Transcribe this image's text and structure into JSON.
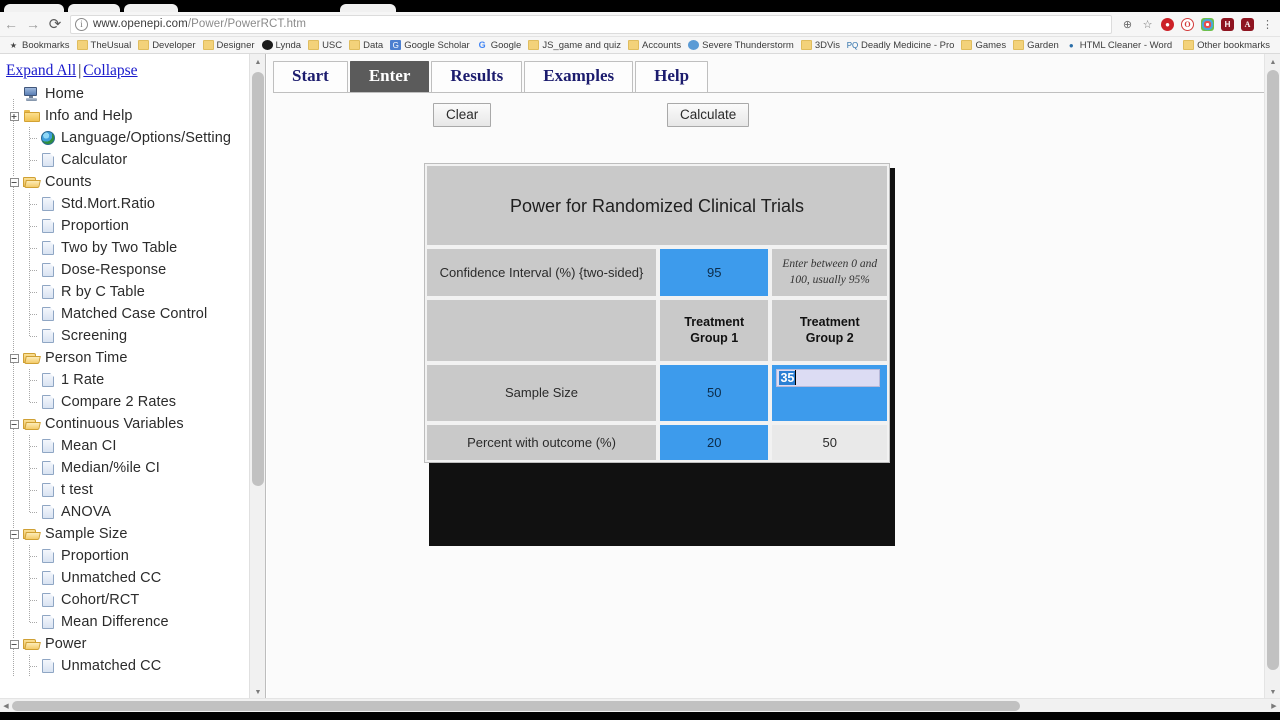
{
  "browser": {
    "url_prefix": "www.openepi.com",
    "url_path": "/Power/PowerRCT.htm",
    "back_icon": "←",
    "forward_icon": "→",
    "reload_icon": "⟳",
    "info_icon": "i",
    "zoom_icon": "⊕",
    "star_icon": "☆",
    "menu_icon": "⋮",
    "extensions": [
      {
        "name": "adblock-extension-icon",
        "glyph": "⛔",
        "color": "#cc2027"
      },
      {
        "name": "opera-extension-icon",
        "glyph": "O",
        "color": "#d23b3b"
      },
      {
        "name": "colorpicker-extension-icon",
        "glyph": "✿",
        "color": "#4aa8d8"
      },
      {
        "name": "evernote-extension-icon",
        "glyph": "H",
        "color": "#8e1420"
      },
      {
        "name": "adobe-acrobat-extension-icon",
        "glyph": "A",
        "color": "#8e1420"
      }
    ],
    "bookmarks": [
      {
        "label": "Bookmarks",
        "icon": "star"
      },
      {
        "label": "TheUsual",
        "icon": "folder"
      },
      {
        "label": "Developer",
        "icon": "folder"
      },
      {
        "label": "Designer",
        "icon": "folder"
      },
      {
        "label": "Lynda",
        "icon": "dark"
      },
      {
        "label": "USC",
        "icon": "folder"
      },
      {
        "label": "Data",
        "icon": "folder"
      },
      {
        "label": "Google Scholar",
        "icon": "scholar"
      },
      {
        "label": "Google",
        "icon": "google"
      },
      {
        "label": "JS_game and quiz",
        "icon": "folder"
      },
      {
        "label": "Accounts",
        "icon": "folder"
      },
      {
        "label": "Severe Thunderstorm",
        "icon": "blue"
      },
      {
        "label": "3DVis",
        "icon": "folder"
      },
      {
        "label": "Deadly Medicine - Pro",
        "icon": "pq"
      },
      {
        "label": "Games",
        "icon": "folder"
      },
      {
        "label": "Garden",
        "icon": "folder"
      },
      {
        "label": "HTML Cleaner - Word",
        "icon": "person"
      }
    ],
    "other_bookmarks": {
      "label": "Other bookmarks",
      "icon": "folder"
    }
  },
  "sidebar": {
    "expand_all": "Expand All",
    "separator": "|",
    "collapse": "Collapse",
    "nodes": [
      {
        "label": "Home",
        "depth": 0,
        "icon": "home",
        "expander": "none"
      },
      {
        "label": "Info and Help",
        "depth": 0,
        "icon": "folder",
        "expander": "plus"
      },
      {
        "label": "Language/Options/Setting",
        "depth": 1,
        "icon": "globe",
        "expander": "none"
      },
      {
        "label": "Calculator",
        "depth": 1,
        "icon": "page",
        "expander": "none"
      },
      {
        "label": "Counts",
        "depth": 0,
        "icon": "folderopen",
        "expander": "minus"
      },
      {
        "label": "Std.Mort.Ratio",
        "depth": 1,
        "icon": "page",
        "expander": "none"
      },
      {
        "label": "Proportion",
        "depth": 1,
        "icon": "page",
        "expander": "none"
      },
      {
        "label": "Two by Two Table",
        "depth": 1,
        "icon": "page",
        "expander": "none"
      },
      {
        "label": "Dose-Response",
        "depth": 1,
        "icon": "page",
        "expander": "none"
      },
      {
        "label": "R by C Table",
        "depth": 1,
        "icon": "page",
        "expander": "none"
      },
      {
        "label": "Matched Case Control",
        "depth": 1,
        "icon": "page",
        "expander": "none"
      },
      {
        "label": "Screening",
        "depth": 1,
        "icon": "page",
        "expander": "none",
        "last": true
      },
      {
        "label": "Person Time",
        "depth": 0,
        "icon": "folderopen",
        "expander": "minus"
      },
      {
        "label": "1 Rate",
        "depth": 1,
        "icon": "page",
        "expander": "none"
      },
      {
        "label": "Compare 2 Rates",
        "depth": 1,
        "icon": "page",
        "expander": "none",
        "last": true
      },
      {
        "label": "Continuous Variables",
        "depth": 0,
        "icon": "folderopen",
        "expander": "minus"
      },
      {
        "label": "Mean CI",
        "depth": 1,
        "icon": "page",
        "expander": "none"
      },
      {
        "label": "Median/%ile CI",
        "depth": 1,
        "icon": "page",
        "expander": "none"
      },
      {
        "label": "t test",
        "depth": 1,
        "icon": "page",
        "expander": "none"
      },
      {
        "label": "ANOVA",
        "depth": 1,
        "icon": "page",
        "expander": "none",
        "last": true
      },
      {
        "label": "Sample Size",
        "depth": 0,
        "icon": "folderopen",
        "expander": "minus"
      },
      {
        "label": "Proportion",
        "depth": 1,
        "icon": "page",
        "expander": "none"
      },
      {
        "label": "Unmatched CC",
        "depth": 1,
        "icon": "page",
        "expander": "none"
      },
      {
        "label": "Cohort/RCT",
        "depth": 1,
        "icon": "page",
        "expander": "none"
      },
      {
        "label": "Mean Difference",
        "depth": 1,
        "icon": "page",
        "expander": "none",
        "last": true
      },
      {
        "label": "Power",
        "depth": 0,
        "icon": "folderopen",
        "expander": "minus"
      },
      {
        "label": "Unmatched CC",
        "depth": 1,
        "icon": "page",
        "expander": "none"
      }
    ]
  },
  "main": {
    "tabs": [
      {
        "label": "Start",
        "active": false
      },
      {
        "label": "Enter",
        "active": true
      },
      {
        "label": "Results",
        "active": false
      },
      {
        "label": "Examples",
        "active": false
      },
      {
        "label": "Help",
        "active": false
      }
    ],
    "clear_button": "Clear",
    "calculate_button": "Calculate",
    "calculator": {
      "title": "Power for Randomized Clinical Trials",
      "rows": [
        {
          "type": "input-hint",
          "label": "Confidence Interval (%)  {two-sided}",
          "value": "95",
          "hint": "Enter between 0 and 100, usually 95%"
        },
        {
          "type": "group-header",
          "label": "",
          "group1": "Treatment\nGroup 1",
          "group2": "Treatment\nGroup 2"
        },
        {
          "type": "two-value",
          "label": "Sample Size",
          "group1_value": "50",
          "group2_value": "35",
          "group2_editing": true
        },
        {
          "type": "two-value",
          "label": "Percent with outcome (%)",
          "group1_value": "20",
          "group2_value": "50",
          "group2_editing": false
        }
      ],
      "accent_blue": "#3d9bec",
      "cell_gray": "#c9c9c9",
      "plain_cell": "#e9e9e9",
      "selection_blue": "#2a7fd4",
      "input_bg": "#dcdcf3"
    }
  }
}
